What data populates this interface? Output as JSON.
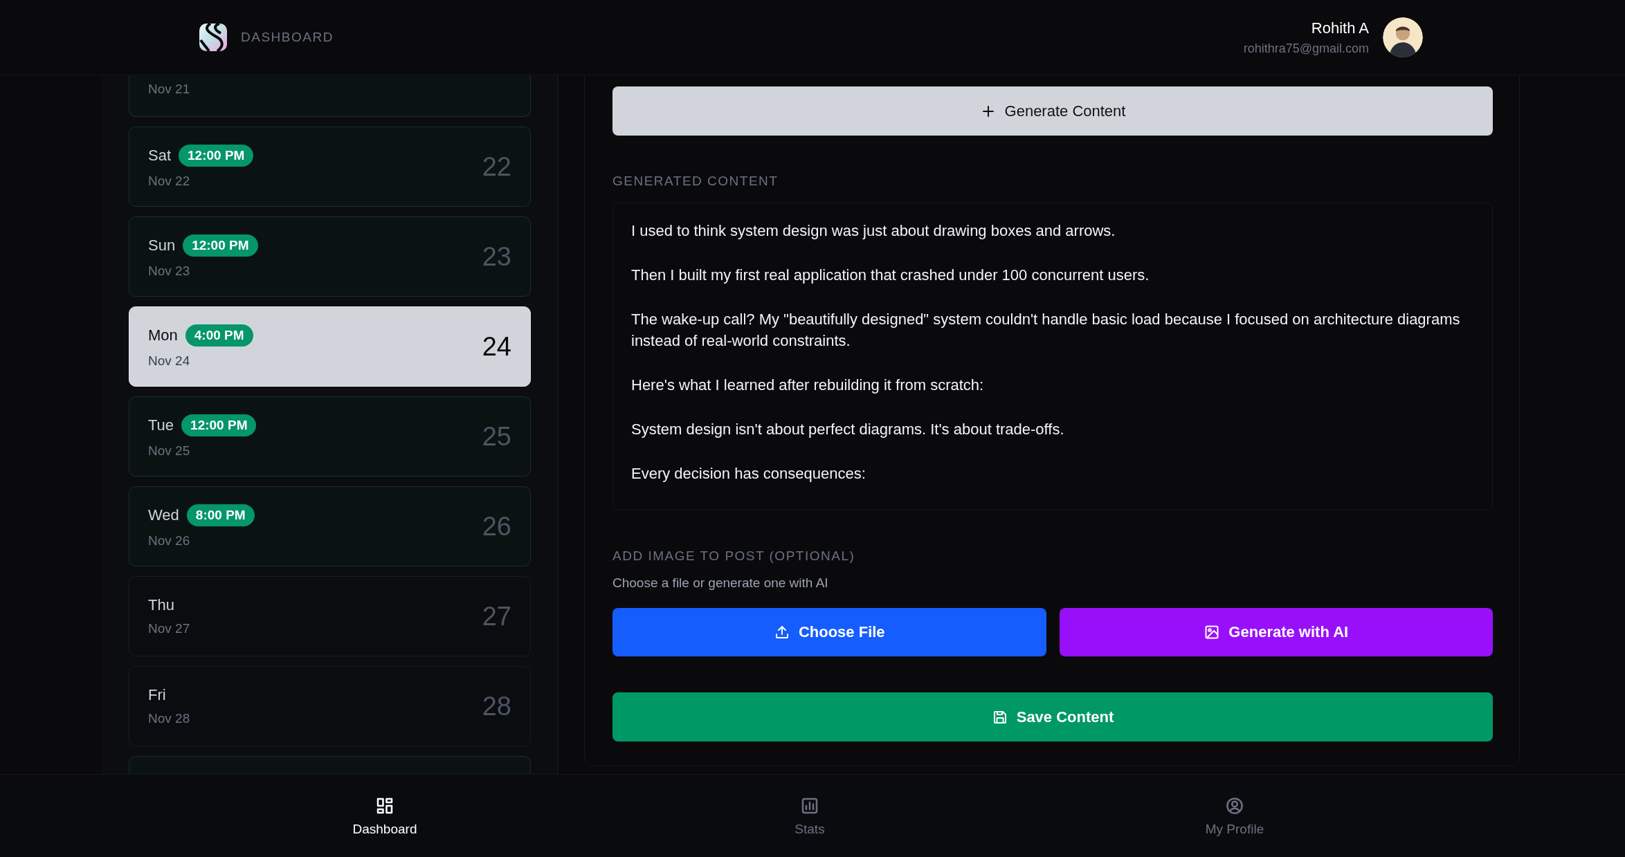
{
  "header": {
    "logo_text": "DASHBOARD",
    "user": {
      "name": "Rohith A",
      "email": "rohithra75@gmail.com"
    }
  },
  "schedule": [
    {
      "kind": "cut_top",
      "date": "Nov 21",
      "scheduled": true,
      "selected": false
    },
    {
      "day": "Sat",
      "time": "12:00 PM",
      "date": "Nov 22",
      "number": "22",
      "scheduled": true,
      "selected": false
    },
    {
      "day": "Sun",
      "time": "12:00 PM",
      "date": "Nov 23",
      "number": "23",
      "scheduled": true,
      "selected": false
    },
    {
      "day": "Mon",
      "time": "4:00 PM",
      "date": "Nov 24",
      "number": "24",
      "scheduled": true,
      "selected": true
    },
    {
      "day": "Tue",
      "time": "12:00 PM",
      "date": "Nov 25",
      "number": "25",
      "scheduled": true,
      "selected": false
    },
    {
      "day": "Wed",
      "time": "8:00 PM",
      "date": "Nov 26",
      "number": "26",
      "scheduled": true,
      "selected": false
    },
    {
      "day": "Thu",
      "date": "Nov 27",
      "number": "27",
      "scheduled": false,
      "selected": false
    },
    {
      "day": "Fri",
      "date": "Nov 28",
      "number": "28",
      "scheduled": false,
      "selected": false
    },
    {
      "kind": "cut_bottom",
      "scheduled": true,
      "selected": false
    }
  ],
  "editor": {
    "generate_button": "Generate Content",
    "generated_label": "GENERATED CONTENT",
    "paragraphs": [
      "I used to think system design was just about drawing boxes and arrows.",
      "Then I built my first real application that crashed under 100 concurrent users.",
      "The wake-up call? My \"beautifully designed\" system couldn't handle basic load because I focused on architecture diagrams instead of real-world constraints.",
      "Here's what I learned after rebuilding it from scratch:",
      "System design isn't about perfect diagrams. It's about trade-offs.",
      "Every decision has consequences:"
    ],
    "image_label": "ADD IMAGE TO POST (OPTIONAL)",
    "image_hint": "Choose a file or generate one with AI",
    "buttons": [
      {
        "kind": "upload",
        "label": "Choose File"
      },
      {
        "kind": "ai",
        "label": "Generate with AI"
      }
    ],
    "save_button": "Save Content"
  },
  "bottom_nav": [
    {
      "kind": "dashboard",
      "label": "Dashboard",
      "selected": true
    },
    {
      "kind": "stats",
      "label": "Stats",
      "selected": false
    },
    {
      "kind": "profile",
      "label": "My Profile",
      "selected": false
    }
  ]
}
